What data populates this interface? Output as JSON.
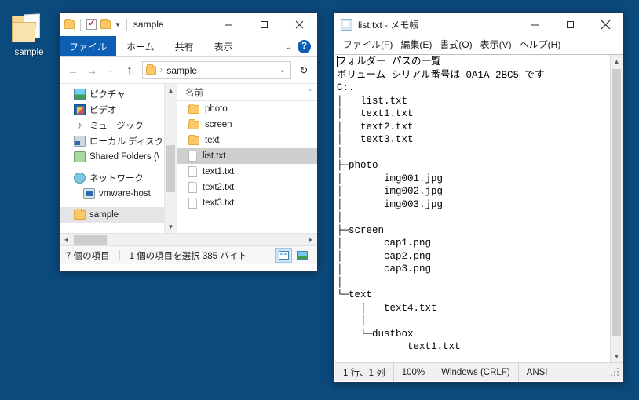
{
  "desktop": {
    "background_color": "#0b4a7c",
    "icons": [
      {
        "label": "sample",
        "icon": "folder-icon"
      }
    ]
  },
  "explorer": {
    "title": "sample",
    "quick_access": {
      "folder_icon": "folder-icon",
      "properties_icon": "properties-icon",
      "new_folder_icon": "new-folder-icon",
      "customize_icon": "chevron-down-icon"
    },
    "window_controls": {
      "minimize": "minimize-icon",
      "maximize": "maximize-icon",
      "close": "close-icon"
    },
    "ribbon": {
      "file_tab": "ファイル",
      "tabs": [
        "ホーム",
        "共有",
        "表示"
      ],
      "expand_icon": "chevron-down-icon",
      "help_label": "?"
    },
    "navigation": {
      "back_icon": "arrow-left-icon",
      "forward_icon": "arrow-right-icon",
      "recent_icon": "chevron-down-icon",
      "up_icon": "arrow-up-icon",
      "refresh_icon": "refresh-icon",
      "address": {
        "folder_icon": "folder-icon",
        "separator": "›",
        "crumb": "sample",
        "dropdown_icon": "chevron-down-icon"
      }
    },
    "tree": {
      "items": [
        {
          "label": "ピクチャ",
          "icon": "pictures-icon",
          "indent": 1,
          "selected": false
        },
        {
          "label": "ビデオ",
          "icon": "video-icon",
          "indent": 1,
          "selected": false
        },
        {
          "label": "ミュージック",
          "icon": "music-icon",
          "indent": 1,
          "selected": false
        },
        {
          "label": "ローカル ディスク (C",
          "icon": "disk-icon",
          "indent": 1,
          "selected": false
        },
        {
          "label": "Shared Folders (\\",
          "icon": "shared-icon",
          "indent": 1,
          "selected": false
        },
        {
          "label": "ネットワーク",
          "icon": "network-icon",
          "indent": 0,
          "selected": false
        },
        {
          "label": "vmware-host",
          "icon": "pc-icon",
          "indent": 1,
          "selected": false
        },
        {
          "label": "sample",
          "icon": "folder-icon",
          "indent": 0,
          "selected": true
        }
      ]
    },
    "file_list": {
      "column_header": "名前",
      "sort_icon": "chevron-up-icon",
      "rows": [
        {
          "name": "photo",
          "type": "folder",
          "selected": false
        },
        {
          "name": "screen",
          "type": "folder",
          "selected": false
        },
        {
          "name": "text",
          "type": "folder",
          "selected": false
        },
        {
          "name": "list.txt",
          "type": "file",
          "selected": true
        },
        {
          "name": "text1.txt",
          "type": "file",
          "selected": false
        },
        {
          "name": "text2.txt",
          "type": "file",
          "selected": false
        },
        {
          "name": "text3.txt",
          "type": "file",
          "selected": false
        }
      ]
    },
    "status": {
      "item_count": "7 個の項目",
      "selection": "1 個の項目を選択  385 バイト",
      "details_view_icon": "details-view-icon",
      "large_icons_view_icon": "large-icons-view-icon"
    }
  },
  "notepad": {
    "title": "list.txt - メモ帳",
    "icon": "notepad-icon",
    "window_controls": {
      "minimize": "minimize-icon",
      "maximize": "maximize-icon",
      "close": "close-icon"
    },
    "menu": [
      "ファイル(F)",
      "編集(E)",
      "書式(O)",
      "表示(V)",
      "ヘルプ(H)"
    ],
    "content": "フォルダー パスの一覧\nボリューム シリアル番号は 0A1A-2BC5 です\nC:.\n│   list.txt\n│   text1.txt\n│   text2.txt\n│   text3.txt\n│\n├─photo\n│       img001.jpg\n│       img002.jpg\n│       img003.jpg\n│\n├─screen\n│       cap1.png\n│       cap2.png\n│       cap3.png\n│\n└─text\n    │   text4.txt\n    │\n    └─dustbox\n            text1.txt",
    "scrollbar": {
      "up_icon": "chevron-up-icon",
      "down_icon": "chevron-down-icon"
    },
    "status": {
      "cursor": "1 行、1 列",
      "zoom": "100%",
      "line_ending": "Windows (CRLF)",
      "encoding": "ANSI",
      "grip_icon": "resize-grip-icon"
    }
  }
}
